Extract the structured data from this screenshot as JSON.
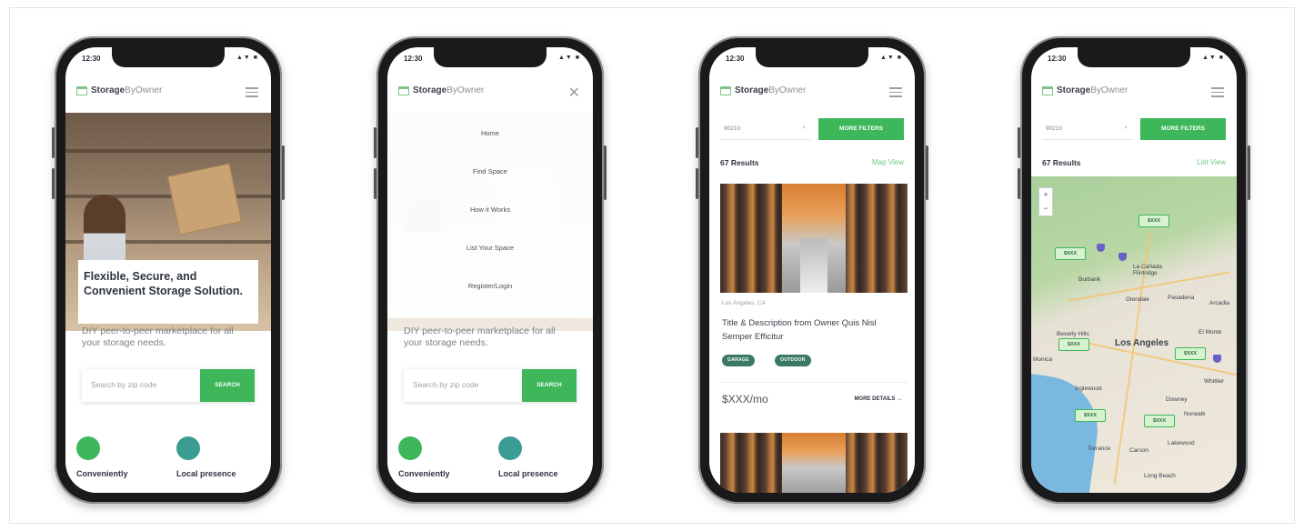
{
  "brand": {
    "name_bold": "Storage",
    "name_light": "ByOwner"
  },
  "status": {
    "time": "12:30",
    "icons": "▲▼ ■"
  },
  "home": {
    "title": "Flexible, Secure, and Convenient Storage Solution.",
    "subtitle": "DIY peer-to-peer marketplace for all your storage needs.",
    "zip_placeholder": "Search by zip code",
    "search_label": "SEARCH",
    "features": [
      "Conveniently",
      "Local presence"
    ]
  },
  "menu": {
    "items": [
      "Home",
      "Find Space",
      "How it Works",
      "List Your Space",
      "Register/Login"
    ],
    "close_icon": "close-icon"
  },
  "list_view": {
    "search_value": "90210",
    "filters_label": "MORE FILTERS",
    "results": "67 Results",
    "toggle_map": "Map View",
    "location": "Los Angeles, CA",
    "listing_title": "Title & Description from Owner Quis Nisl Semper Efficitur",
    "tags": [
      "GARAGE",
      "OUTDOOR"
    ],
    "price": "$XXX/mo",
    "more_details": "MORE DETAILS →"
  },
  "map_view": {
    "search_value": "90210",
    "filters_label": "MORE FILTERS",
    "results": "67 Results",
    "toggle_list": "List View",
    "zoom_in": "+",
    "zoom_out": "−",
    "pins": [
      "$XXX",
      "$XXX",
      "$XXX",
      "$XXX",
      "$XXX"
    ],
    "places": [
      "Burbank",
      "La Cañada Flintridge",
      "Glendale",
      "Pasadena",
      "Arcadia",
      "Beverly Hills",
      "Los Angeles",
      "El Monte",
      "Inglewood",
      "Downey",
      "Whittier",
      "Norwalk",
      "Torrance",
      "Carson",
      "Lakewood",
      "Long Beach",
      "Monica"
    ]
  },
  "colors": {
    "accent": "#3db75a",
    "tag": "#3b7a62",
    "link": "#6cc882"
  }
}
